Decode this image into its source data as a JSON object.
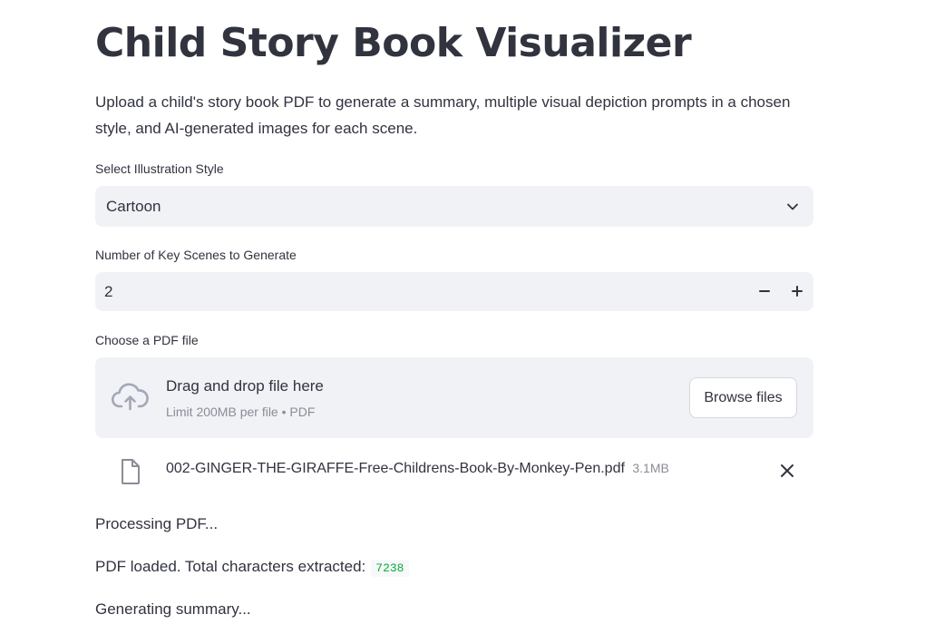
{
  "page": {
    "title": "Child Story Book Visualizer",
    "description": "Upload a child's story book PDF to generate a summary, multiple visual depiction prompts in a chosen style, and AI-generated images for each scene."
  },
  "style_select": {
    "label": "Select Illustration Style",
    "value": "Cartoon",
    "icon": "chevron-down-icon"
  },
  "scenes_input": {
    "label": "Number of Key Scenes to Generate",
    "value": "2",
    "minus_icon": "minus-icon",
    "plus_icon": "plus-icon"
  },
  "uploader": {
    "label": "Choose a PDF file",
    "drag_text": "Drag and drop file here",
    "limit_text": "Limit 200MB per file • PDF",
    "browse_label": "Browse files",
    "icon": "cloud-upload-icon"
  },
  "uploaded_file": {
    "name": "002-GINGER-THE-GIRAFFE-Free-Childrens-Book-By-Monkey-Pen.pdf",
    "size": "3.1MB",
    "icon": "file-icon",
    "remove_icon": "close-icon"
  },
  "status": {
    "processing": "Processing PDF...",
    "loaded": "PDF loaded. Total characters extracted:",
    "char_count": "7238",
    "generating": "Generating summary..."
  },
  "colors": {
    "text": "#31333f",
    "muted": "#8a8d96",
    "widget_bg": "#f0f2f6",
    "code_green": "#09ab3b",
    "icon_gray": "#a3a8b8"
  }
}
